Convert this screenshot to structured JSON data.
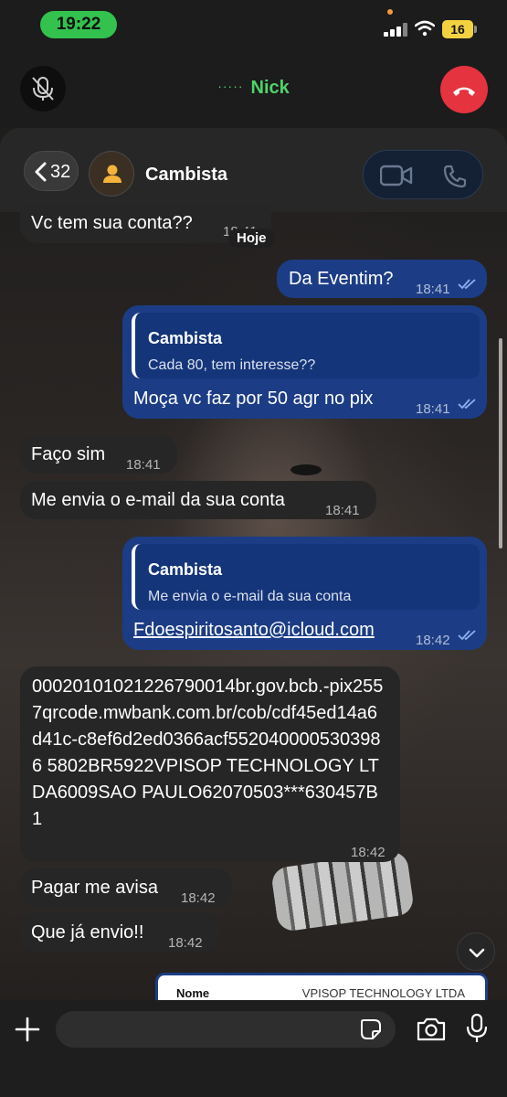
{
  "status_bar": {
    "time": "19:22",
    "battery": "16"
  },
  "call": {
    "dots": "·····",
    "name": "Nick"
  },
  "header": {
    "back_count": "32",
    "title": "Cambista"
  },
  "date_separator": "Hoje",
  "messages": [
    {
      "dir": "in",
      "text": "Vc tem sua conta??",
      "time": "18:41"
    },
    {
      "dir": "out",
      "text": "Da Eventim?",
      "time": "18:41"
    },
    {
      "dir": "out",
      "reply_name": "Cambista",
      "reply_text": "Cada 80, tem interesse??",
      "text": "Moça vc faz por 50 agr no pix",
      "time": "18:41"
    },
    {
      "dir": "in",
      "text": "Faço sim",
      "time": "18:41"
    },
    {
      "dir": "in",
      "text": "Me envia o e-mail da sua conta",
      "time": "18:41"
    },
    {
      "dir": "out",
      "reply_name": "Cambista",
      "reply_text": "Me envia o e-mail da sua conta",
      "text": "Fdoespiritosanto@icloud.com",
      "time": "18:42"
    },
    {
      "dir": "in",
      "text": "00020101021226790014br.gov.bcb.-pix2557qrcode.mwbank.com.br/cob/cdf45ed14a6d41c-c8ef6d2ed0366acf5520400005303986 5802BR5922VPISOP TECHNOLOGY LTDA6009SAO PAULO62070503***630457B1",
      "time": "18:42"
    },
    {
      "dir": "in",
      "text": "Pagar me avisa",
      "time": "18:42"
    },
    {
      "dir": "in",
      "text": "Que já envio!!",
      "time": "18:42"
    }
  ],
  "receipt_card": {
    "label": "Nome",
    "value": "VPISOP TECHNOLOGY LTDA"
  },
  "colors": {
    "outgoing": "#1c3d86",
    "incoming": "#262626",
    "call_green": "#33c24d",
    "end_call": "#e5333f"
  }
}
